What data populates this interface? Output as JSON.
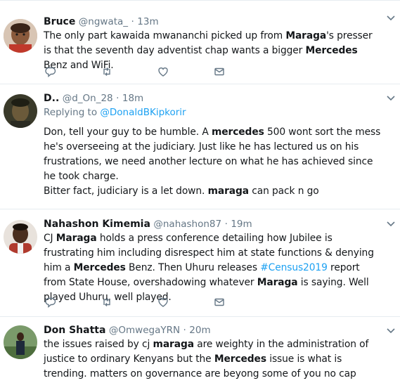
{
  "tweets": [
    {
      "name": "Bruce",
      "handle": "@ngwata_",
      "dot": "·",
      "time": "13m",
      "text_parts": [
        {
          "t": "The only part kawaida mwananchi picked up from ",
          "b": false
        },
        {
          "t": "Maraga",
          "b": true
        },
        {
          "t": "'s presser is that the seventh day adventist chap wants a bigger ",
          "b": false
        },
        {
          "t": "Mercedes",
          "b": true
        },
        {
          "t": " Benz and WiFi.",
          "b": false
        }
      ]
    },
    {
      "name": "D..",
      "handle": "@d_On_28",
      "dot": "·",
      "time": "18m",
      "replying_label": "Replying to",
      "replying_to": "@DonaldBKipkorir",
      "text_parts": [
        {
          "t": "Don, tell your guy to be humble. A ",
          "b": false
        },
        {
          "t": "mercedes",
          "b": true
        },
        {
          "t": " 500 wont sort the mess he's overseeing at the judiciary. Just like he has lectured us on his frustrations, we need another lecture on what he has achieved since he took charge.",
          "b": false
        },
        {
          "t": "\n",
          "b": false
        },
        {
          "t": "Bitter fact, judiciary is a let down. ",
          "b": false
        },
        {
          "t": "maraga",
          "b": true
        },
        {
          "t": " can pack n go",
          "b": false
        }
      ]
    },
    {
      "name": "Nahashon Kimemia",
      "handle": "@nahashon87",
      "dot": "·",
      "time": "19m",
      "text_parts": [
        {
          "t": "CJ ",
          "b": false
        },
        {
          "t": "Maraga",
          "b": true
        },
        {
          "t": " holds a press conference detailing how Jubilee is frustrating him including disrespect him at state functions & denying him a ",
          "b": false
        },
        {
          "t": "Mercedes",
          "b": true
        },
        {
          "t": " Benz. Then Uhuru releases ",
          "b": false
        },
        {
          "t": "#Census2019",
          "b": false,
          "tag": true
        },
        {
          "t": " report from State House, overshadowing whatever ",
          "b": false
        },
        {
          "t": "Maraga",
          "b": true
        },
        {
          "t": " is saying. Well played Uhuru, well played.",
          "b": false
        }
      ]
    },
    {
      "name": "Don Shatta",
      "handle": "@OmwegaYRN",
      "dot": "·",
      "time": "20m",
      "text_parts": [
        {
          "t": "the issues raised by cj ",
          "b": false
        },
        {
          "t": "maraga",
          "b": true
        },
        {
          "t": " are weighty in the administration of justice to ordinary Kenyans but the ",
          "b": false
        },
        {
          "t": "Mercedes",
          "b": true
        },
        {
          "t": " issue is what is trending. matters on governance are beyong some of you no cap",
          "b": false
        }
      ]
    }
  ],
  "icons": {
    "reply": "reply-icon",
    "retweet": "retweet-icon",
    "like": "heart-icon",
    "dm": "envelope-icon",
    "caret": "chevron-down-icon"
  },
  "colors": {
    "text": "#14171a",
    "muted": "#657786",
    "link": "#1da1f2",
    "divider": "#e6ecf0"
  }
}
